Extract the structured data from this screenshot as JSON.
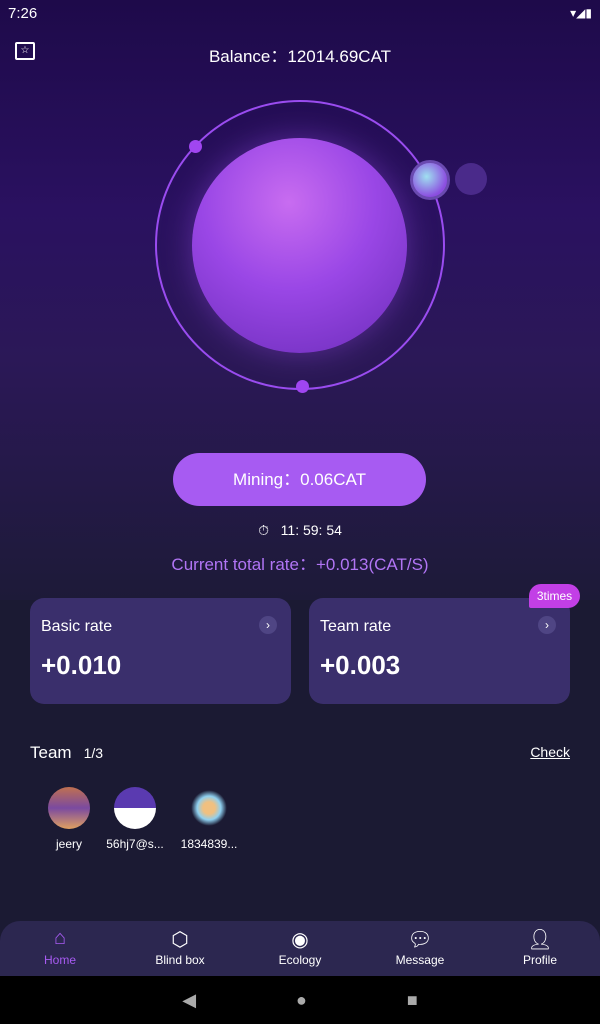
{
  "status_bar": {
    "time": "7:26",
    "right": "▾◢▮"
  },
  "header": {
    "balance": "Balance：12014.69CAT"
  },
  "mining": {
    "button": "Mining：0.06CAT",
    "timer": "11: 59: 54",
    "total_rate": "Current total rate：+0.013(CAT/S)"
  },
  "cards": [
    {
      "title": "Basic rate",
      "value": "+0.010"
    },
    {
      "title": "Team rate",
      "value": "+0.003",
      "badge": "3times"
    }
  ],
  "team": {
    "title": "Team",
    "count": "1/3",
    "check": "Check",
    "members": [
      {
        "name": "jeery"
      },
      {
        "name": "56hj7@s..."
      },
      {
        "name": "1834839..."
      }
    ]
  },
  "nav": [
    {
      "label": "Home",
      "active": true,
      "accent": "#a75bf2"
    },
    {
      "label": "Blind box"
    },
    {
      "label": "Ecology"
    },
    {
      "label": "Message"
    },
    {
      "label": "Profile"
    }
  ]
}
